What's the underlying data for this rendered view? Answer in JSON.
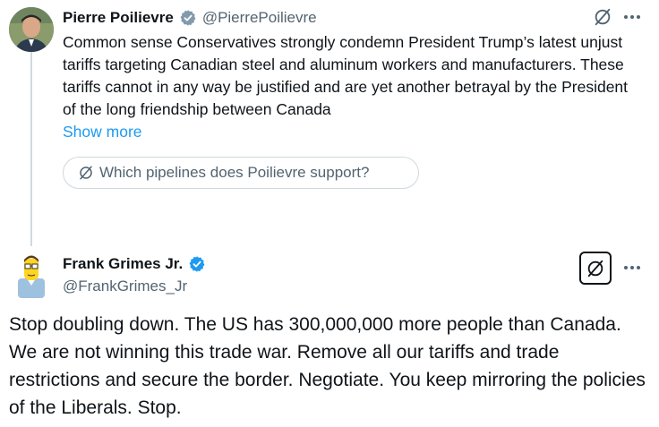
{
  "parent_tweet": {
    "author_name": "Pierre Poilievre",
    "author_handle": "@PierrePoilievre",
    "text": "Common sense Conservatives strongly condemn President Trump’s latest unjust tariffs targeting Canadian steel and aluminum workers and manufacturers. These tariffs cannot in any way be justified and are yet another betrayal by the President of the long friendship between Canada",
    "show_more": "Show more",
    "grok_prompt": "Which pipelines does Poilievre support?"
  },
  "reply_tweet": {
    "author_name": "Frank Grimes Jr.",
    "author_handle": "@FrankGrimes_Jr",
    "text": "Stop doubling down. The US has 300,000,000 more people than Canada. We are not winning this trade war. Remove all our tariffs and trade restrictions and secure the border. Negotiate. You keep mirroring the policies of the Liberals. Stop."
  },
  "colors": {
    "verified_gray": "#829aab",
    "verified_blue": "#1d9bf0",
    "link": "#1d9bf0",
    "secondary_text": "#536471",
    "border": "#cfd9de"
  },
  "icons": [
    "verified-badge-icon",
    "grok-icon",
    "more-icon"
  ]
}
